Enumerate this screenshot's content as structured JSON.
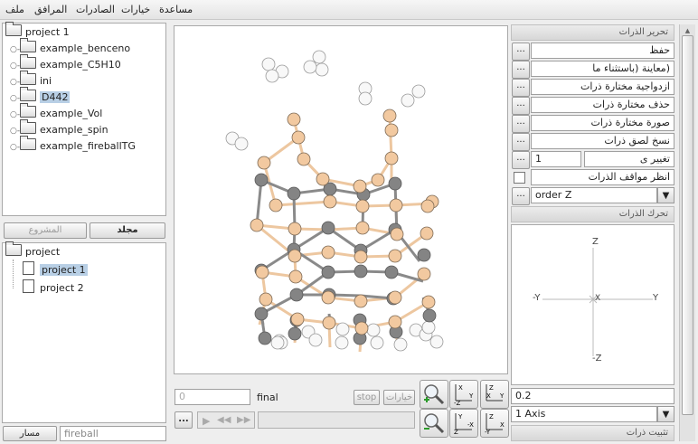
{
  "menu": [
    "ملف",
    "المرافق",
    "الصادرات",
    "خيارات",
    "مساعدة"
  ],
  "project_tree": {
    "root": "project 1",
    "items": [
      "example_benceno",
      "example_C5H10",
      "ini",
      "D442",
      "example_Vol",
      "example_spin",
      "example_fireballTG"
    ],
    "selected": "D442"
  },
  "tabs": {
    "folder": "مجلد",
    "project": "المشروع"
  },
  "project_list": {
    "root": "project",
    "items": [
      "project 1",
      "project 2"
    ],
    "selected": "project 1"
  },
  "path_bar": {
    "label": "مسار",
    "value": "fireball"
  },
  "animation": {
    "frame": "0",
    "status": "final",
    "stop_label": "stop",
    "options_label": "خيارات"
  },
  "edit_atoms": {
    "header": "تحرير الذرات",
    "save": "حفظ",
    "preview": "(معاينة (باستثناء ما",
    "pair": "ازدواجية مختارة ذرات",
    "delete": "حذف مختارة ذرات",
    "image": "صورة مختارة ذرات",
    "copy": "نسخ لصق ذرات",
    "change_label": "تغيير ى",
    "change_value": "1",
    "view_positions": "انظر مواقف الذرات",
    "order_select": "order Z"
  },
  "move_atoms": {
    "header": "تحرك الذرات",
    "step": "0.2",
    "axis_select": "1 Axis"
  },
  "fix_atoms": {
    "header": "تثبيت ذرات"
  },
  "axis_labels": {
    "top": "Z",
    "bottom": "-Z",
    "left": "-Y",
    "right": "Y",
    "center": "X"
  },
  "view_buttons": [
    "zoom-in-icon",
    "view-zy-icon",
    "view-xy-icon",
    "zoom-out-icon",
    "view-yz-icon",
    "view-xz-icon"
  ],
  "colors": {
    "accent": "#b8cfe5",
    "silicon": "#f2c9a0",
    "carbon": "#848484",
    "hydrogen": "#f8f8f8"
  }
}
